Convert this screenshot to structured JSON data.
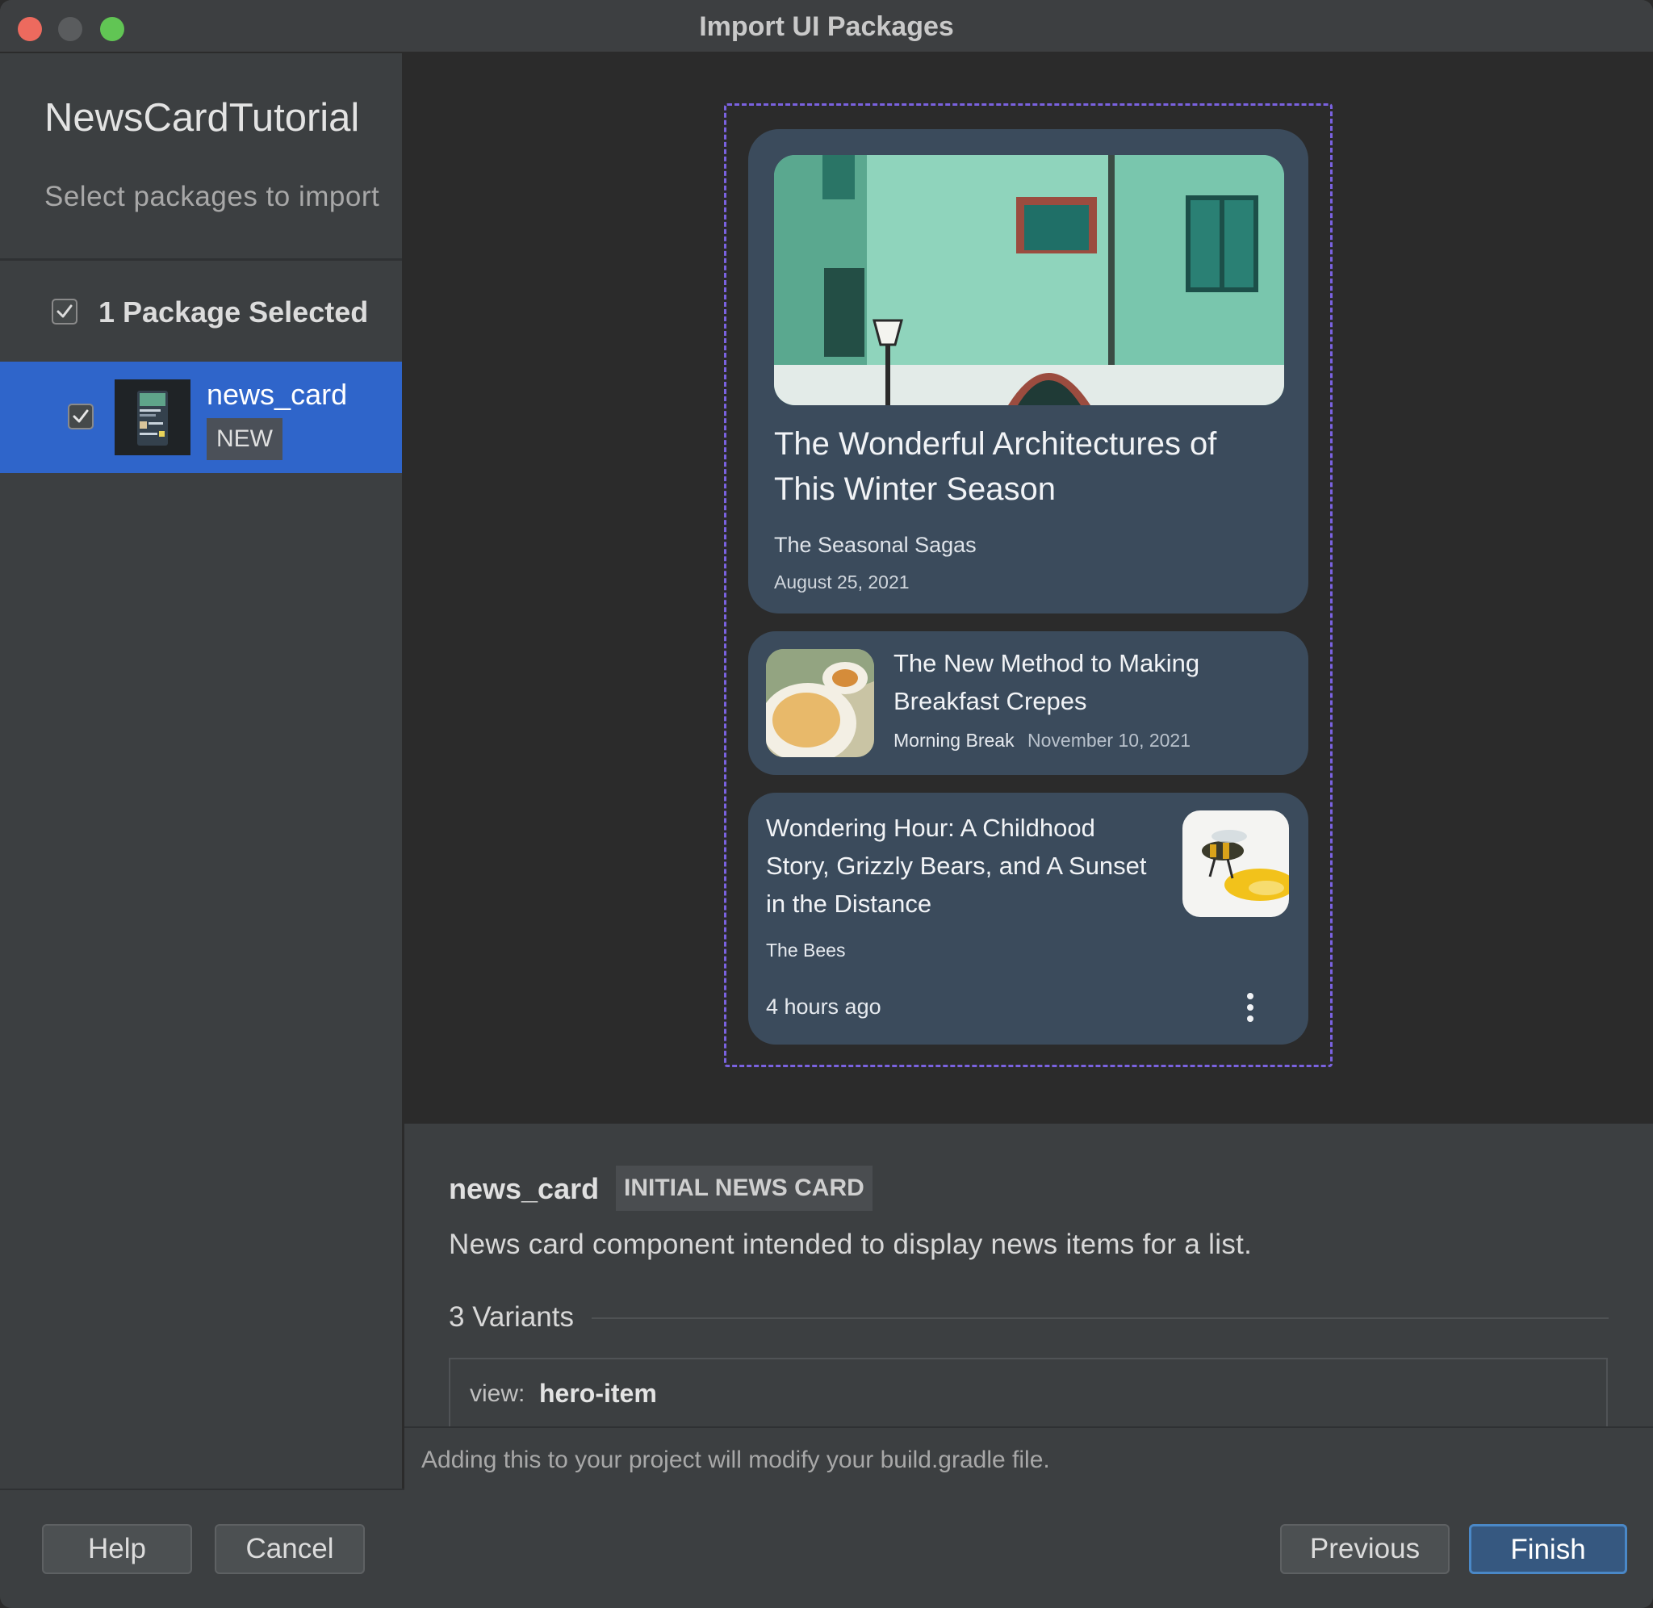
{
  "window": {
    "title": "Import UI Packages",
    "traffic_lights": [
      "#ed6a5e",
      "#5a5c5e",
      "#61c554"
    ]
  },
  "sidebar": {
    "project_name": "NewsCardTutorial",
    "subtitle": "Select packages to import",
    "selection_summary": "1 Package Selected",
    "packages": [
      {
        "name": "news_card",
        "badge": "NEW",
        "checked": true
      }
    ]
  },
  "preview": {
    "hero": {
      "title_line1": "The Wonderful Architectures of",
      "title_line2": "This Winter Season",
      "source": "The Seasonal Sagas",
      "date": "August 25, 2021"
    },
    "compact": {
      "title_line1": "The New Method to Making",
      "title_line2": "Breakfast Crepes",
      "source": "Morning Break",
      "date": "November 10, 2021"
    },
    "detailed": {
      "title_line1": "Wondering Hour: A Childhood",
      "title_line2": "Story, Grizzly Bears, and A Sunset",
      "title_line3": "in the Distance",
      "source": "The Bees",
      "time": "4 hours ago",
      "menu_icon": "more-vert-icon"
    }
  },
  "details": {
    "name": "news_card",
    "tag": "INITIAL NEWS CARD",
    "description": "News card component intended to display news items for a list.",
    "variants_heading": "3 Variants",
    "view_label": "view:",
    "view_value": "hero-item"
  },
  "note": "Adding this to your project will modify your build.gradle file.",
  "buttons": {
    "help": "Help",
    "cancel": "Cancel",
    "previous": "Previous",
    "finish": "Finish"
  },
  "colors": {
    "selection": "#2f65ca",
    "card": "#3b4b5c",
    "dashed_border": "#7a62e0",
    "finish_button": "#365880"
  }
}
